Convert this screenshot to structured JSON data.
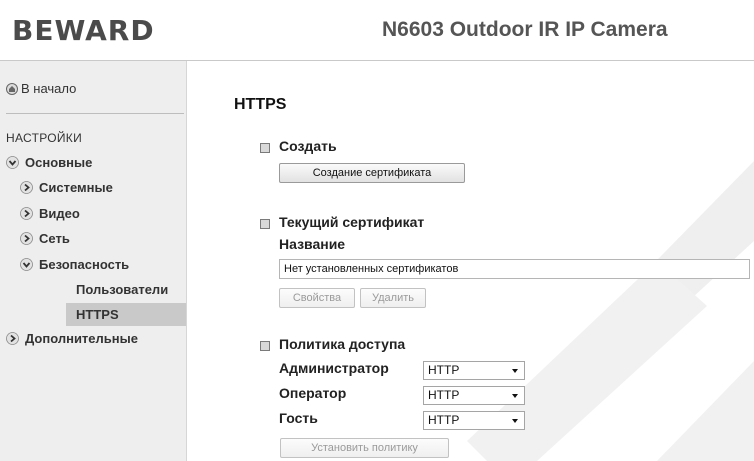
{
  "header": {
    "logo": "BEWARD",
    "camera_title": "N6603 Outdoor IR IP Camera"
  },
  "sidebar": {
    "home_label": "В начало",
    "settings_heading": "НАСТРОЙКИ",
    "basic_label": "Основные",
    "system_label": "Системные",
    "video_label": "Видео",
    "network_label": "Сеть",
    "security_label": "Безопасность",
    "users_label": "Пользователи",
    "https_label": "HTTPS",
    "additional_label": "Дополнительные"
  },
  "main": {
    "page_title": "HTTPS",
    "create": {
      "title": "Создать",
      "button": "Создание сертификата"
    },
    "current": {
      "title": "Текущий сертификат",
      "name_label": "Название",
      "field_value": "Нет установленных сертификатов",
      "properties_button": "Свойства",
      "delete_button": "Удалить"
    },
    "policy": {
      "title": "Политика доступа",
      "admin_label": "Администратор",
      "admin_value": "HTTP",
      "operator_label": "Оператор",
      "operator_value": "HTTP",
      "guest_label": "Гость",
      "guest_value": "HTTP",
      "set_button": "Установить политику"
    }
  },
  "colors": {
    "sidebar_bg": "#eeeeee",
    "active_item_bg": "#c9c9c9",
    "watermark": "#efefef"
  }
}
